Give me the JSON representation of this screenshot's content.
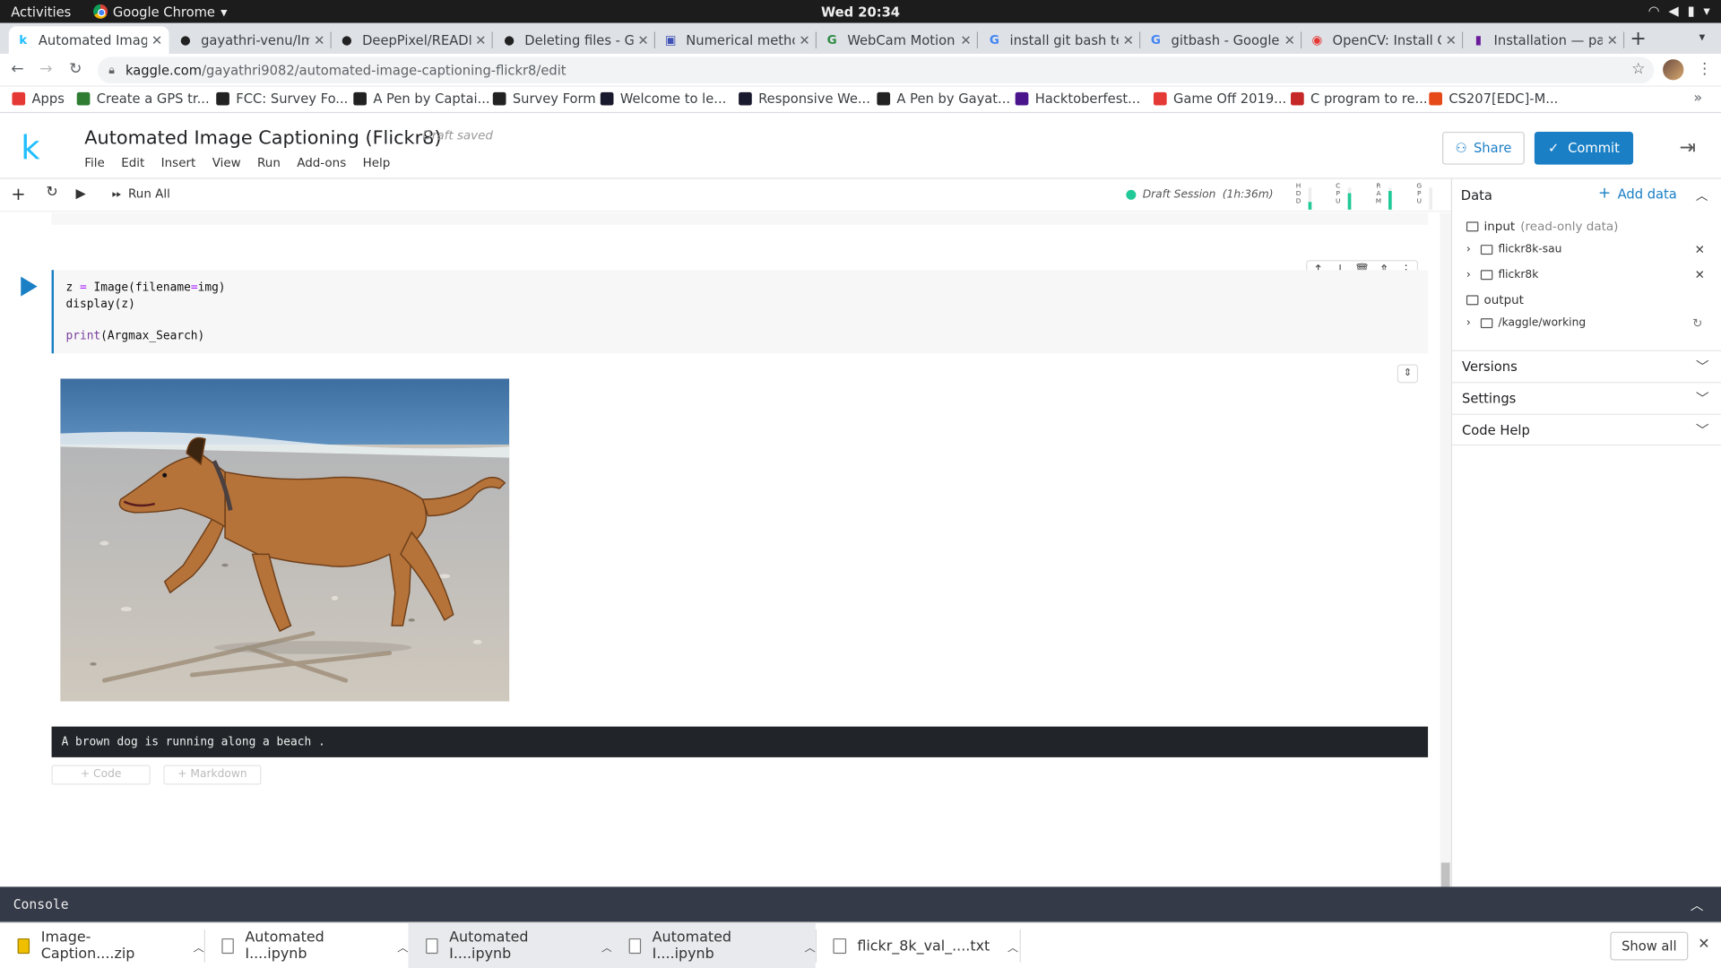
{
  "os": {
    "activities": "Activities",
    "app_name": "Google Chrome",
    "clock": "Wed 20:34"
  },
  "tabs": [
    {
      "title": "Automated Image",
      "icon": "kaggle-icon",
      "fav": "k",
      "color": "#20beff"
    },
    {
      "title": "gayathri-venu/Ima",
      "icon": "github-icon",
      "fav": "●",
      "color": "#222"
    },
    {
      "title": "DeepPixel/READM",
      "icon": "github-icon",
      "fav": "●",
      "color": "#222"
    },
    {
      "title": "Deleting files - Gi",
      "icon": "github-icon",
      "fav": "●",
      "color": "#222"
    },
    {
      "title": "Numerical metho",
      "icon": "classroom-icon",
      "fav": "▣",
      "color": "#3f51b5"
    },
    {
      "title": "WebCam Motion",
      "icon": "gfg-icon",
      "fav": "G",
      "color": "#2f8d46"
    },
    {
      "title": "install git bash te",
      "icon": "google-icon",
      "fav": "G",
      "color": "#4285f4"
    },
    {
      "title": "gitbash - Google",
      "icon": "google-icon",
      "fav": "G",
      "color": "#4285f4"
    },
    {
      "title": "OpenCV: Install O",
      "icon": "opencv-icon",
      "fav": "◉",
      "color": "#e53935"
    },
    {
      "title": "Installation — par",
      "icon": "docs-icon",
      "fav": "▮",
      "color": "#6a1b9a"
    }
  ],
  "address": {
    "host": "kaggle.com",
    "path": "/gayathri9082/automated-image-captioning-flickr8/edit"
  },
  "bookmarks": [
    {
      "label": "Apps",
      "color": "#e53935"
    },
    {
      "label": "Create a GPS tr...",
      "color": "#2e7d32"
    },
    {
      "label": "FCC: Survey Fo...",
      "color": "#222"
    },
    {
      "label": "A Pen by Captai...",
      "color": "#222"
    },
    {
      "label": "Survey Form",
      "color": "#222"
    },
    {
      "label": "Welcome to le...",
      "color": "#1a1a2e"
    },
    {
      "label": "Responsive We...",
      "color": "#1a1a2e"
    },
    {
      "label": "A Pen by Gayat...",
      "color": "#222"
    },
    {
      "label": "Hacktoberfest...",
      "color": "#4a148c"
    },
    {
      "label": "Game Off 2019...",
      "color": "#e53935"
    },
    {
      "label": "C program to re...",
      "color": "#c62828"
    },
    {
      "label": "CS207[EDC]-M...",
      "color": "#e64a19"
    }
  ],
  "kernel": {
    "logo": "k",
    "title": "Automated Image Captioning (Flickr8)",
    "status": "Draft saved",
    "menu": [
      "File",
      "Edit",
      "Insert",
      "View",
      "Run",
      "Add-ons",
      "Help"
    ],
    "share": "Share",
    "commit": "Commit"
  },
  "toolbar": {
    "run_all": "Run All",
    "session": "Draft Session",
    "session_time": "(1h:36m)",
    "gauges": [
      {
        "label": "HDD",
        "level": 0.35
      },
      {
        "label": "CPU",
        "level": 0.75
      },
      {
        "label": "RAM",
        "level": 0.85
      },
      {
        "label": "GPU",
        "level": 0.0
      }
    ]
  },
  "cell": {
    "code": [
      {
        "a": "z ",
        "b": "=",
        "c": " Image(filename",
        "d": "=",
        "e": "img)"
      },
      {
        "a": "display(z)",
        "b": "",
        "c": "",
        "d": "",
        "e": ""
      },
      {
        "a": "",
        "b": "",
        "c": "",
        "d": "",
        "e": ""
      },
      {
        "a": "",
        "b": "print",
        "c": "(Argmax_Search)",
        "d": "",
        "e": ""
      }
    ],
    "image_alt": "Brown dog running on a beach",
    "output": "A brown dog is running along a beach .",
    "add_code": "+ Code",
    "add_markdown": "+ Markdown"
  },
  "data_panel": {
    "title": "Data",
    "add_data": "Add data",
    "input": "input",
    "input_note": "(read-only data)",
    "datasets": [
      "flickr8k-sau",
      "flickr8k"
    ],
    "output": "output",
    "working": "/kaggle/working",
    "sections": [
      "Versions",
      "Settings",
      "Code Help"
    ]
  },
  "console": {
    "label": "Console"
  },
  "downloads": {
    "items": [
      "Image-Caption....zip",
      "Automated I....ipynb",
      "Automated I....ipynb",
      "Automated I....ipynb",
      "flickr_8k_val_....txt"
    ],
    "show_all": "Show all"
  }
}
